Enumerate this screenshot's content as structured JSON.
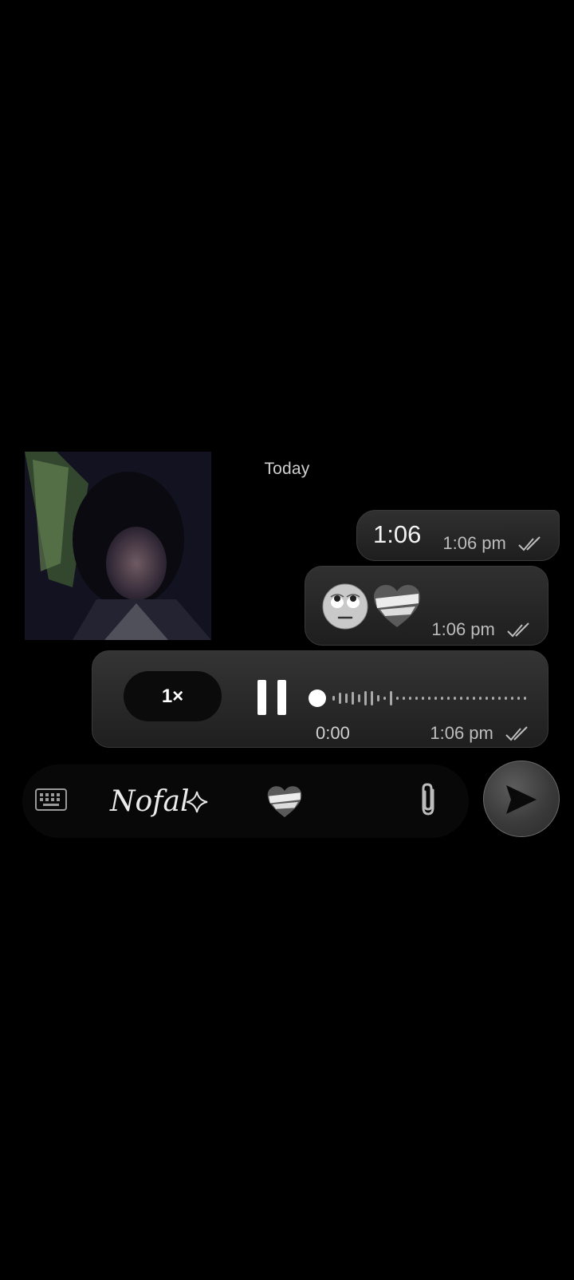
{
  "photo": {
    "icon": "photo-thumbnail"
  },
  "date_separator": "Today",
  "messages": [
    {
      "type": "text",
      "text": "1:06",
      "time": "1:06 pm",
      "status": "read-double-tick"
    },
    {
      "type": "emoji",
      "emojis": [
        "rolling-eyes-face-icon",
        "mending-heart-icon"
      ],
      "time": "1:06 pm",
      "status": "read-double-tick"
    },
    {
      "type": "voice",
      "speed": "1×",
      "duration": "0:00",
      "time": "1:06 pm",
      "status": "read-double-tick",
      "progress": 0
    }
  ],
  "composer": {
    "text": "Nofal",
    "icons": [
      "keyboard-icon",
      "sparkle-icon",
      "mending-heart-icon",
      "paperclip-icon",
      "send-icon"
    ]
  },
  "colors": {
    "background": "#000000",
    "bubble": "#2b2b2b",
    "tick": "#bdbdbd"
  }
}
